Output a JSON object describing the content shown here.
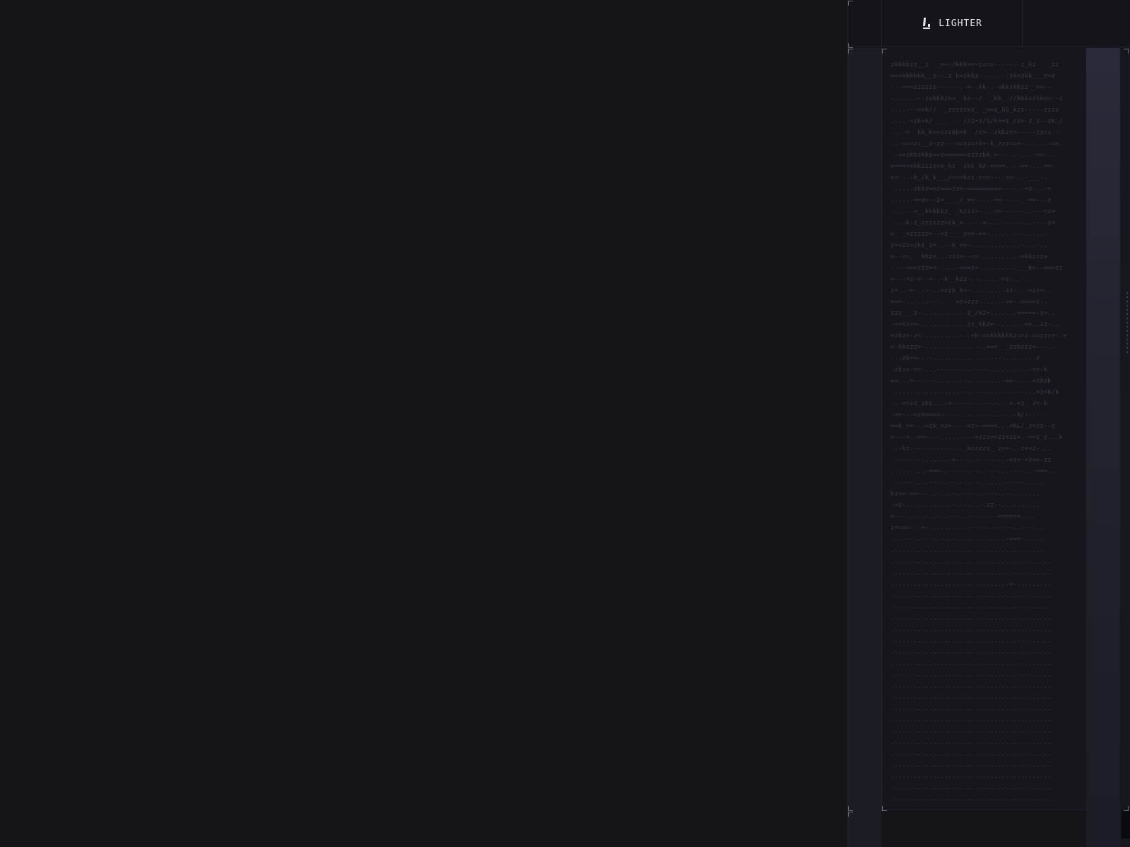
{
  "header": {
    "brand": "LIGHTER",
    "logo_icon": "lighter-logo-icon"
  },
  "colors": {
    "background": "#131318",
    "panel": "#16161c",
    "rail": "#1c1c24",
    "text": "#e6e6ec",
    "ascii": "#3a3a48"
  },
  "art": {
    "lines": [
      "zkkkkzz__z  _=~-/kkk==~zz==-------z_kz   _zz",
      "===kkkkkk__z~-.z k=zkkz---..---zk=zkk___z=z",
      "---===zzzzzz------.-=-.kk-.-=kkzkkzz__==--",
      "-.....---zzkkkzk=_ kz--/  _kk_ //kkkzzkk==--z",
      "-...---==k//  _zzzzzkz_ _==z_GG_kzz-----zzzz",
      "....-=zk=k/ ___    //z=z/G/k==z_/z=-z_z--zk_/",
      "...-=  kk_k==zzzkk=k  /z=--zkkz==-----zz=z--",
      "..-===zz__z-zz---==zz=zk=-k_zzz===-..-...-==.",
      ".-==zkkzkkz==z======zzzzkk_=---..-...-==-..",
      "======kkzzzz=k_kz  zkk_kz-====..--==-...==-",
      "==-..-k_/k_k___/===kzz-===----==-..-___-.",
      ".....-zkkz==z===zz=-=========----.-=z-..-=",
      ".....-==z=--z=____/_==--..-==-----_-==-.-z",
      "......=__kkkkkz_ _kzzz=-..-==------..---=z=",
      "...-k-z_zzzzzz=zk_=..---=....---.--..--.-z=",
      "=_ _=zzzzz=--=z____z==-==-..-..----..-..-",
      "z==zz=zkz_z=..--k_==-.............-...-..",
      "=--==_  kkz=...=zz=--==...........=kkzzz=",
      "----===zzz==-....-===z=..........___k=--===zz",
      "=---=z-=--=-.-k__kzz-.-.....-=z-..-.",
      "z=..-=-.---..=zzk_k=-........-zz-..-=zz=-.",
      "===-..-...---.   =z=zzz-....--==-.====z-.",
      "zzz___z-...........-z_/kz=.......=====-z=..",
      "-==kz==-............zz_kkz=-.......==..zz-..",
      "=zkz=-z=-.........-..=k-==kkkkkkz==z-==zzz=-.=",
      "=-kkzzz=-.............--.===_ _zzkzzz=---.-",
      "---zk==----..............-----......-.z",
      "-zkzz-==-...--------.-----..........-==-k",
      "==...=------.......-...-.....-==-....=zkzk",
      "-....-.......-....--..---...-------...=z=k/k",
      "..-==zz_zkz...-=------------.-.=.=z_ z=-k",
      "-==---=zk====----.......--...-..-k/--.-.",
      "==k_==-.-=zk_=z=----=z=-====...=kL/_z=zz--z",
      "=---=.-==----.....----=zzz==zz=zz=.-==z_z...k",
      "..-kz-----------..._k=zzzz_ z==-.-z==z-...",
      ".-------.......-=---..------..-=z=-=z==-zz",
      ".-...-...-===-.-----.--..---...----..-===..",
      ".-.---....--.-.--.-...-.......-----.....",
      "kz==-==---..-...-.----..----..--.......",
      "-=z-..-.........-..-...-.zz--...-......",
      "=---...-.-..-..---..-----.--======....",
      "z====-.-=-..........-----..-----..----..",
      "...---..---..-..-...........-.-===-.....",
      "........................................",
      "..........................................",
      "...............................-..........",
      "..............................-=-.........",
      "..........................................",
      "..........................................",
      "..........................................",
      "..........................................",
      "..........................................",
      "..........................................",
      "..........................................",
      "..........................................",
      "..........................................",
      "..........................................",
      "..........................................",
      "..........................................",
      "..........................................",
      "..........................................",
      "..........................................",
      "..........................................",
      "..........................................",
      "..........................................",
      "..........................................",
      ".........................................."
    ]
  }
}
